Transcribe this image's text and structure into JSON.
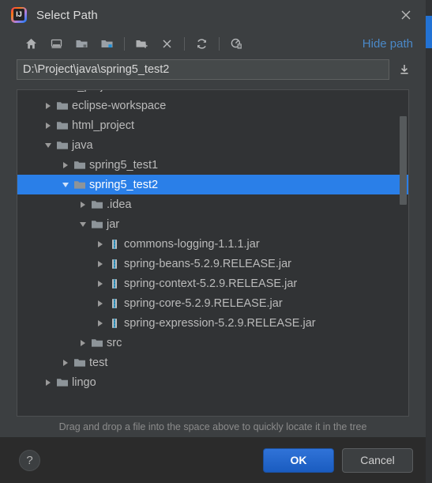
{
  "window": {
    "title": "Select Path",
    "app_icon": "intellij-idea-icon",
    "close_icon": "close-icon"
  },
  "toolbar": {
    "buttons": [
      {
        "name": "home-icon",
        "tooltip": "Home"
      },
      {
        "name": "desktop-icon",
        "tooltip": "Desktop"
      },
      {
        "name": "project-folder-icon",
        "tooltip": "Project"
      },
      {
        "name": "module-folder-icon",
        "tooltip": "Module"
      },
      {
        "name": "new-folder-icon",
        "tooltip": "New Folder"
      },
      {
        "name": "delete-icon",
        "tooltip": "Delete"
      },
      {
        "name": "refresh-icon",
        "tooltip": "Refresh"
      },
      {
        "name": "show-hidden-icon",
        "tooltip": "Show Hidden Files"
      }
    ],
    "hide_path_label": "Hide path"
  },
  "path": {
    "value": "D:\\Project\\java\\spring5_test2",
    "placeholder": "",
    "expand_icon": "download-icon"
  },
  "tree": {
    "nodes": [
      {
        "label": "c_project",
        "indent": 1,
        "state": "collapsed",
        "icon": "folder-icon",
        "selected": false
      },
      {
        "label": "eclipse-workspace",
        "indent": 1,
        "state": "collapsed",
        "icon": "folder-icon",
        "selected": false
      },
      {
        "label": "html_project",
        "indent": 1,
        "state": "collapsed",
        "icon": "folder-icon",
        "selected": false
      },
      {
        "label": "java",
        "indent": 1,
        "state": "expanded",
        "icon": "folder-icon",
        "selected": false
      },
      {
        "label": "spring5_test1",
        "indent": 2,
        "state": "collapsed",
        "icon": "folder-icon",
        "selected": false
      },
      {
        "label": "spring5_test2",
        "indent": 2,
        "state": "expanded",
        "icon": "folder-icon",
        "selected": true
      },
      {
        "label": ".idea",
        "indent": 3,
        "state": "collapsed",
        "icon": "folder-icon",
        "selected": false
      },
      {
        "label": "jar",
        "indent": 3,
        "state": "expanded",
        "icon": "folder-icon",
        "selected": false
      },
      {
        "label": "commons-logging-1.1.1.jar",
        "indent": 4,
        "state": "collapsed",
        "icon": "jar-icon",
        "selected": false
      },
      {
        "label": "spring-beans-5.2.9.RELEASE.jar",
        "indent": 4,
        "state": "collapsed",
        "icon": "jar-icon",
        "selected": false
      },
      {
        "label": "spring-context-5.2.9.RELEASE.jar",
        "indent": 4,
        "state": "collapsed",
        "icon": "jar-icon",
        "selected": false
      },
      {
        "label": "spring-core-5.2.9.RELEASE.jar",
        "indent": 4,
        "state": "collapsed",
        "icon": "jar-icon",
        "selected": false
      },
      {
        "label": "spring-expression-5.2.9.RELEASE.jar",
        "indent": 4,
        "state": "collapsed",
        "icon": "jar-icon",
        "selected": false
      },
      {
        "label": "src",
        "indent": 3,
        "state": "collapsed",
        "icon": "folder-icon",
        "selected": false
      },
      {
        "label": "test",
        "indent": 2,
        "state": "collapsed",
        "icon": "folder-icon",
        "selected": false
      },
      {
        "label": "lingo",
        "indent": 1,
        "state": "collapsed",
        "icon": "folder-icon",
        "selected": false
      }
    ]
  },
  "hint": {
    "text": "Drag and drop a file into the space above to quickly locate it in the tree"
  },
  "footer": {
    "help_label": "?",
    "ok_label": "OK",
    "cancel_label": "Cancel"
  },
  "colors": {
    "accent": "#2a7fe8",
    "link": "#4a88c7",
    "dialog_bg": "#3c3f41",
    "tree_bg": "#313335",
    "footer_bg": "#2b2b2b",
    "ok_button": "#2064c9"
  }
}
